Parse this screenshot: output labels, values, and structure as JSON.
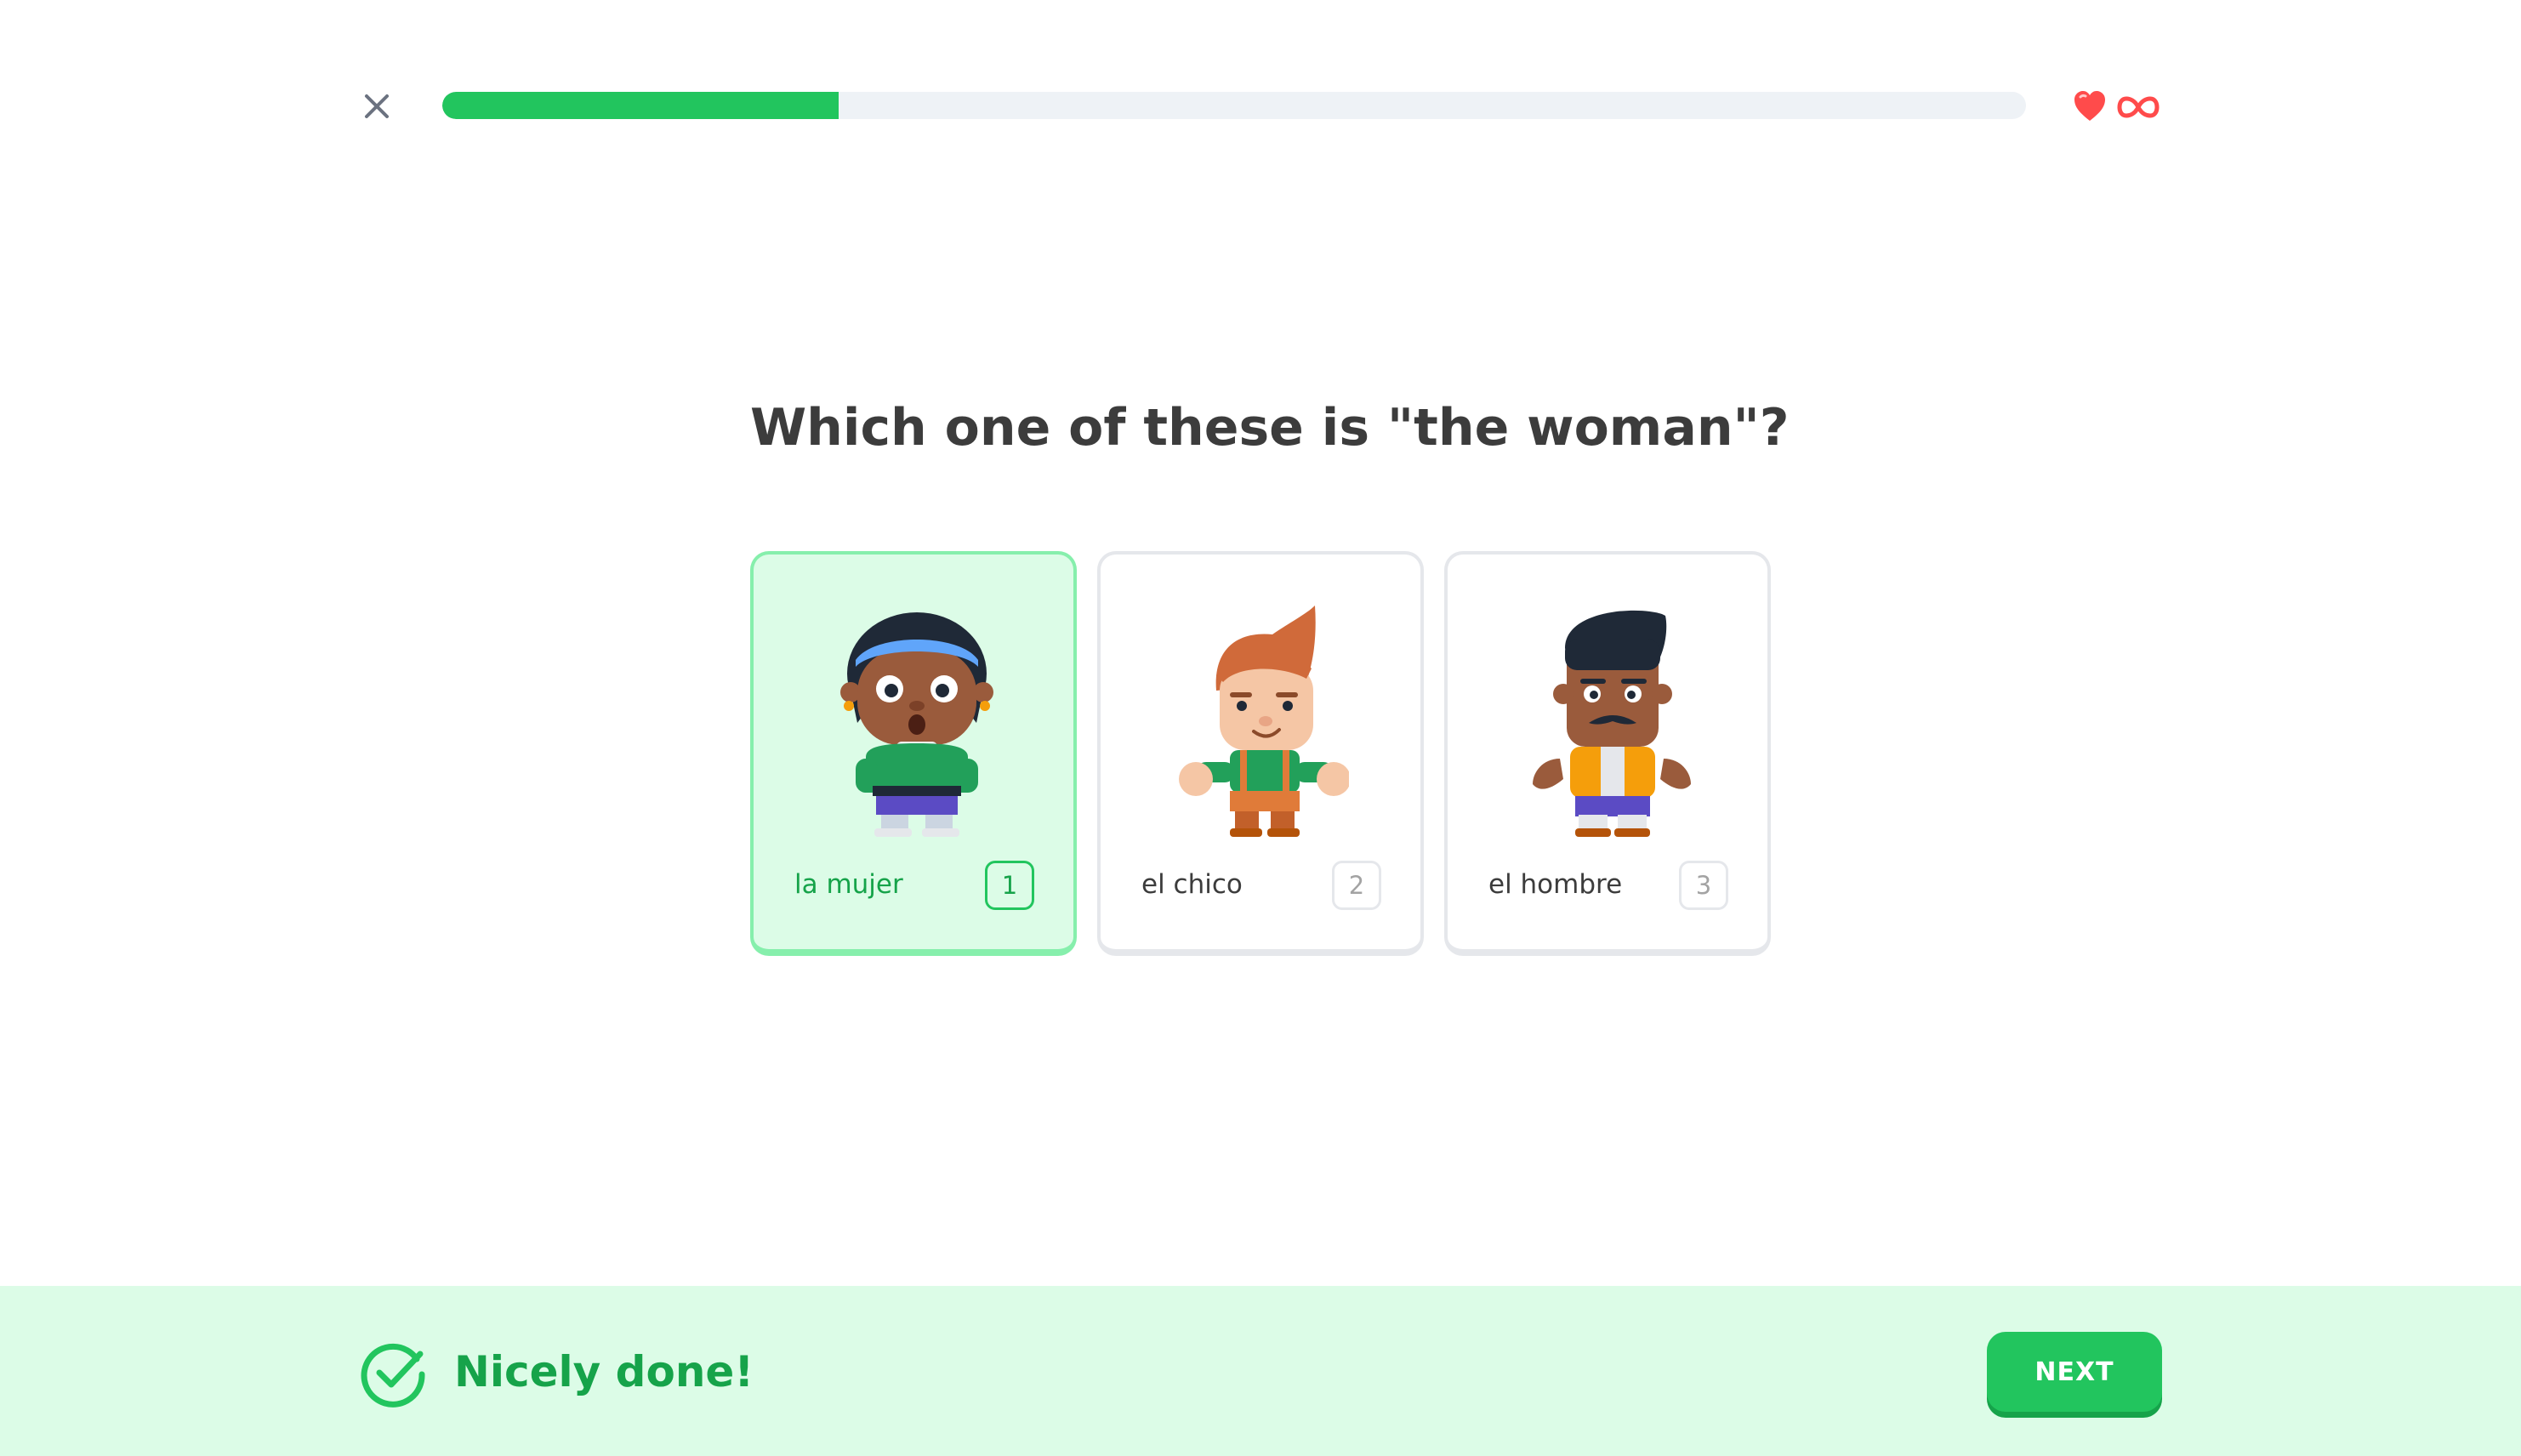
{
  "header": {
    "close_icon": "close-icon",
    "progress": 0.25,
    "progress_color": "#22c55e",
    "hearts_icon": "heart-icon",
    "hearts_value_icon": "infinity-icon",
    "hearts_color": "#ff4b4b"
  },
  "question": {
    "text": "Which one of these is \"the woman\"?"
  },
  "options": [
    {
      "label": "la mujer",
      "key": "1",
      "selected": true,
      "figure": "woman-figure"
    },
    {
      "label": "el chico",
      "key": "2",
      "selected": false,
      "figure": "boy-figure"
    },
    {
      "label": "el hombre",
      "key": "3",
      "selected": false,
      "figure": "man-figure"
    }
  ],
  "feedback": {
    "icon": "check-circle-icon",
    "message": "Nicely done!",
    "next_label": "NEXT",
    "accent": "#22c55e",
    "background": "#dcfce7"
  }
}
